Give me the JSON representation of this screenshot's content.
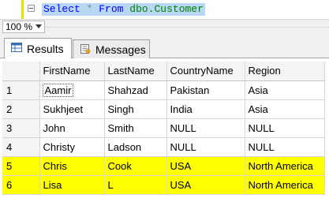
{
  "editor": {
    "kw_select": "Select",
    "star": "*",
    "kw_from": "From",
    "object": "dbo.Customer"
  },
  "zoom": {
    "value": "100 %"
  },
  "tabs": [
    {
      "label": "Results",
      "icon": "results-grid-icon"
    },
    {
      "label": "Messages",
      "icon": "messages-icon"
    }
  ],
  "grid": {
    "columns": [
      "FirstName",
      "LastName",
      "CountryName",
      "Region"
    ],
    "rows": [
      {
        "n": "1",
        "cells": [
          "Aamir",
          "Shahzad",
          "Pakistan",
          "Asia"
        ],
        "highlighted": false
      },
      {
        "n": "2",
        "cells": [
          "Sukhjeet",
          "Singh",
          "India",
          "Asia"
        ],
        "highlighted": false
      },
      {
        "n": "3",
        "cells": [
          "John",
          "Smith",
          "NULL",
          "NULL"
        ],
        "highlighted": false
      },
      {
        "n": "4",
        "cells": [
          "Christy",
          "Ladson",
          "NULL",
          "NULL"
        ],
        "highlighted": false
      },
      {
        "n": "5",
        "cells": [
          "Chris",
          "Cook",
          "USA",
          "North America"
        ],
        "highlighted": true
      },
      {
        "n": "6",
        "cells": [
          "Lisa",
          "L",
          "USA",
          "North America"
        ],
        "highlighted": true
      }
    ]
  },
  "colors": {
    "highlight": "#ffff00",
    "sql_keyword": "#0000ff",
    "sql_object": "#008000",
    "selection_bg": "#b7d7f2"
  }
}
